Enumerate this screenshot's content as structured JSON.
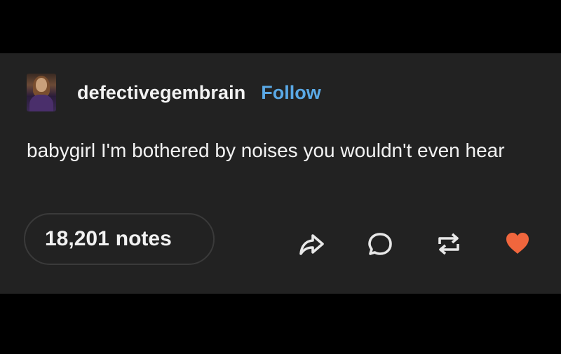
{
  "post": {
    "username": "defectivegembrain",
    "follow_label": "Follow",
    "text": "babygirl I'm bothered by noises you wouldn't even hear",
    "notes_count": "18,201",
    "notes_label": "notes"
  },
  "actions": {
    "share_icon": "share-arrow-icon",
    "reply_icon": "speech-bubble-icon",
    "reblog_icon": "reblog-icon",
    "like_icon": "heart-icon"
  },
  "colors": {
    "background": "#000000",
    "card": "#222222",
    "text": "#f2f2f2",
    "follow": "#5aa9e6",
    "heart": "#f0663d"
  }
}
